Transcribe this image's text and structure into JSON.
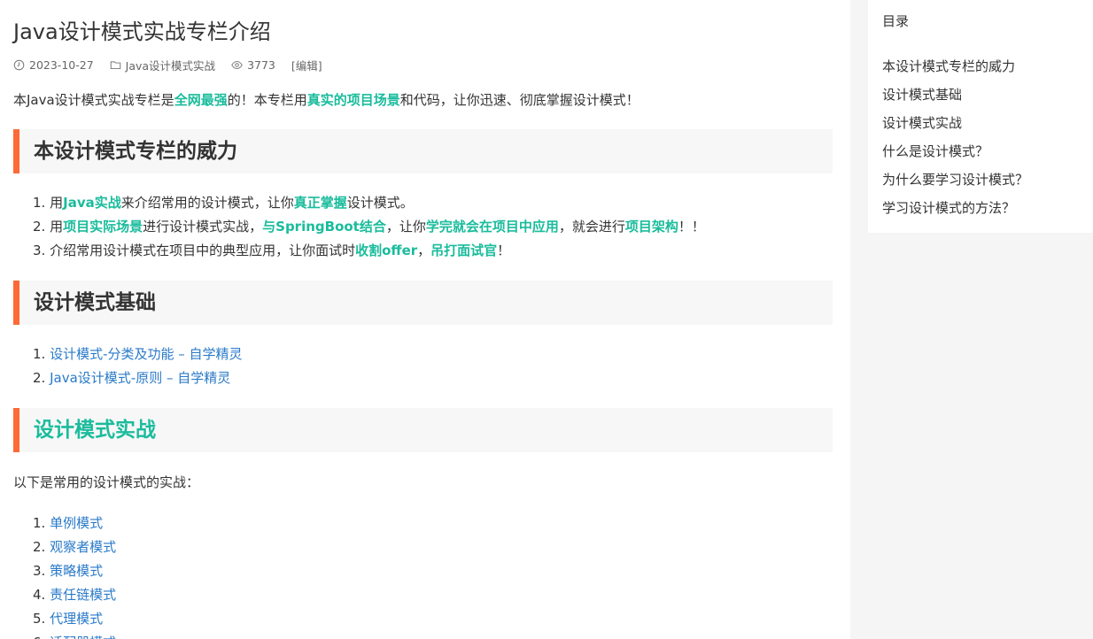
{
  "article": {
    "title": "Java设计模式实战专栏介绍",
    "meta": {
      "date": "2023-10-27",
      "category": "Java设计模式实战",
      "views": "3773",
      "edit": "[编辑]"
    },
    "intro": [
      {
        "t": "本Java设计模式实战专栏是",
        "hl": false
      },
      {
        "t": "全网最强",
        "hl": true
      },
      {
        "t": "的！本专栏用",
        "hl": false
      },
      {
        "t": "真实的项目场景",
        "hl": true
      },
      {
        "t": "和代码，让你迅速、彻底掌握设计模式！",
        "hl": false
      }
    ],
    "sections": {
      "power": {
        "heading": "本设计模式专栏的威力",
        "items": [
          [
            {
              "t": "用",
              "hl": false
            },
            {
              "t": "Java实战",
              "hl": true
            },
            {
              "t": "来介绍常用的设计模式，让你",
              "hl": false
            },
            {
              "t": "真正掌握",
              "hl": true
            },
            {
              "t": "设计模式。",
              "hl": false
            }
          ],
          [
            {
              "t": "用",
              "hl": false
            },
            {
              "t": "项目实际场景",
              "hl": true
            },
            {
              "t": "进行设计模式实战，",
              "hl": false
            },
            {
              "t": "与SpringBoot结合",
              "hl": true
            },
            {
              "t": "，让你",
              "hl": false
            },
            {
              "t": "学完就会在项目中应用",
              "hl": true
            },
            {
              "t": "，就会进行",
              "hl": false
            },
            {
              "t": "项目架构",
              "hl": true
            },
            {
              "t": "！！",
              "hl": false
            }
          ],
          [
            {
              "t": "介绍常用设计模式在项目中的典型应用，让你面试时",
              "hl": false
            },
            {
              "t": "收割offer",
              "hl": true
            },
            {
              "t": "，",
              "hl": false
            },
            {
              "t": "吊打面试官",
              "hl": true
            },
            {
              "t": "！",
              "hl": false
            }
          ]
        ]
      },
      "basics": {
        "heading": "设计模式基础",
        "links": [
          "设计模式-分类及功能 – 自学精灵",
          "Java设计模式-原则 – 自学精灵"
        ]
      },
      "practice": {
        "heading": "设计模式实战",
        "desc": "以下是常用的设计模式的实战：",
        "links": [
          "单例模式",
          "观察者模式",
          "策略模式",
          "责任链模式",
          "代理模式",
          "适配器模式"
        ]
      }
    }
  },
  "toc": {
    "title": "目录",
    "items": [
      "本设计模式专栏的威力",
      "设计模式基础",
      "设计模式实战",
      "什么是设计模式？",
      "为什么要学习设计模式？",
      "学习设计模式的方法？"
    ]
  },
  "colors": {
    "accent_bar": "#fd6a37",
    "highlight": "#1abc9c",
    "link": "#2a7ac8",
    "heading_bg": "#f7f7f7"
  }
}
